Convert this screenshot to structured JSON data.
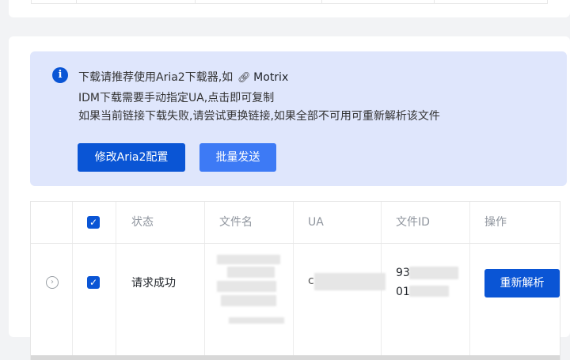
{
  "notice": {
    "icon": "info-icon",
    "line1_prefix": "下载请推荐使用Aria2下载器,如",
    "link_label": "Motrix",
    "line2": "IDM下载需要手动指定UA,点击即可复制",
    "line3": "如果当前链接下载失败,请尝试更换链接,如果全部不可用可重新解析该文件"
  },
  "buttons": {
    "aria2_config": "修改Aria2配置",
    "batch_send": "批量发送"
  },
  "table": {
    "headers": [
      "状态",
      "文件名",
      "UA",
      "文件ID",
      "操作"
    ],
    "rows": [
      {
        "status": "请求成功",
        "file_id_part1": "93",
        "file_id_part2": "01",
        "action": "重新解析",
        "ua_char": "c"
      }
    ]
  },
  "colors": {
    "primary": "#0a55d5",
    "notice_bg": "#dfe6fc",
    "secondary_button": "#3d7af5"
  }
}
